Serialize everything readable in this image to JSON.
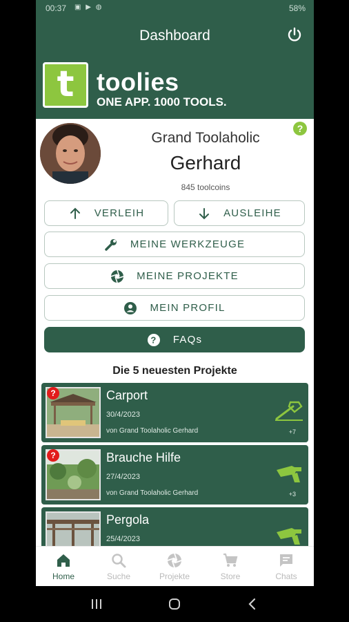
{
  "status_bar": {
    "time": "00:37",
    "icons": "▣ ▶ ◍",
    "right": "58%"
  },
  "app_bar": {
    "title": "Dashboard"
  },
  "brand": {
    "logo_letter": "t",
    "name": "toolies",
    "slogan": "ONE APP. 1000 TOOLS."
  },
  "profile": {
    "rank": "Grand Toolaholic",
    "name": "Gerhard",
    "coins": "845 toolcoins",
    "help": "?"
  },
  "buttons": {
    "verleih": "VERLEIH",
    "ausleihe": "AUSLEIHE",
    "werkzeuge": "MEINE WERKZEUGE",
    "projekte": "MEINE PROJEKTE",
    "profil": "MEIN PROFIL",
    "faqs": "FAQs"
  },
  "section_title": "Die 5 neuesten Projekte",
  "projects": [
    {
      "title": "Carport",
      "date": "30/4/2023",
      "author": "von Grand Toolaholic Gerhard",
      "count": "+7",
      "badge": "?"
    },
    {
      "title": "Brauche Hilfe",
      "date": "27/4/2023",
      "author": "von Grand Toolaholic Gerhard",
      "count": "+3",
      "badge": "?"
    },
    {
      "title": "Pergola",
      "date": "25/4/2023",
      "author": "",
      "count": "",
      "badge": ""
    }
  ],
  "nav": [
    {
      "label": "Home",
      "icon": "home-icon"
    },
    {
      "label": "Suche",
      "icon": "search-icon"
    },
    {
      "label": "Projekte",
      "icon": "aperture-icon"
    },
    {
      "label": "Store",
      "icon": "cart-icon"
    },
    {
      "label": "Chats",
      "icon": "chat-icon"
    }
  ],
  "colors": {
    "primary": "#2f5e4a",
    "accent": "#8dc63f",
    "badge": "#e21b1b"
  }
}
